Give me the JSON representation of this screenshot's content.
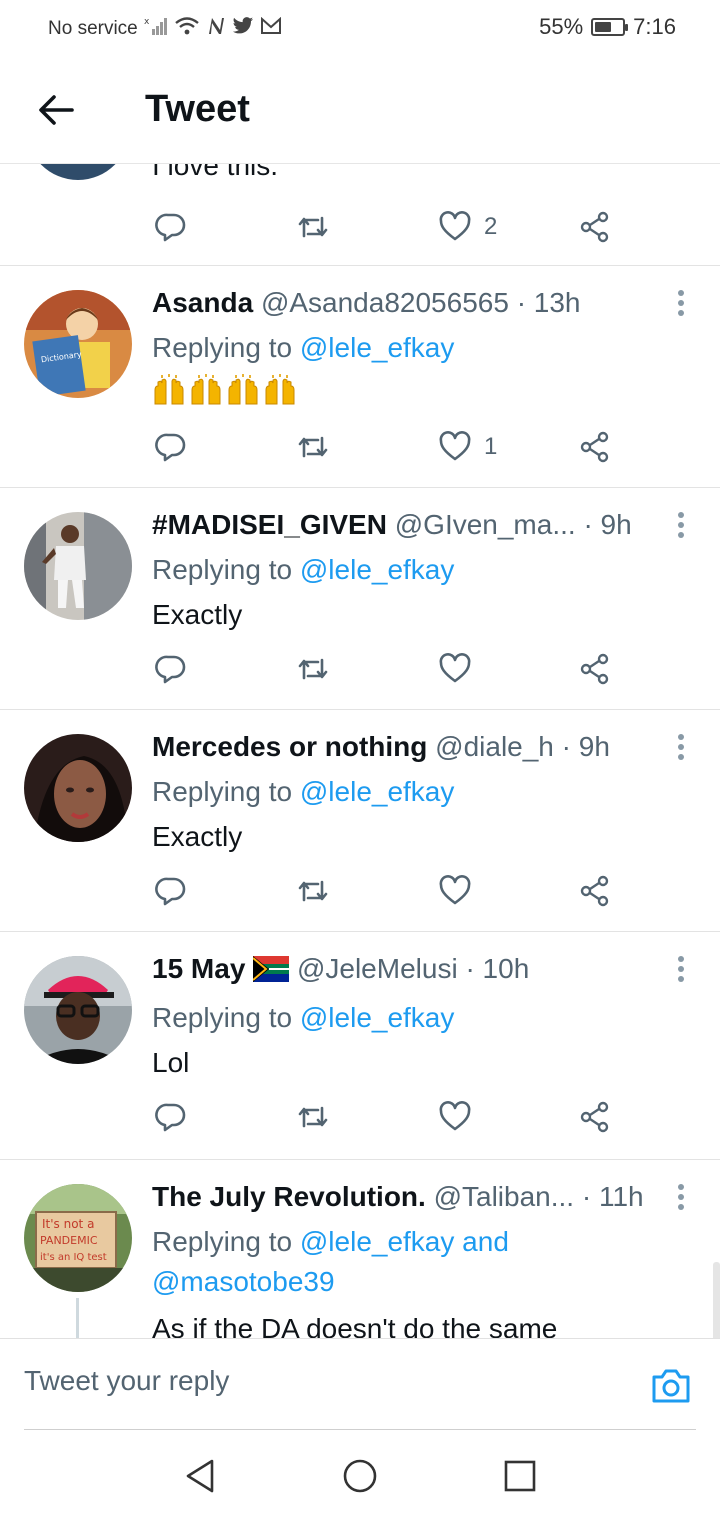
{
  "status_bar": {
    "carrier": "No service",
    "battery_percent": "55%",
    "battery_level": 0.55,
    "time": "7:16",
    "icons": [
      "signal-off-icon",
      "wifi-icon",
      "n-icon",
      "twitter-icon",
      "gmail-icon"
    ]
  },
  "header": {
    "title": "Tweet"
  },
  "partial_tweet": {
    "text": "I love this.",
    "like_count": "2"
  },
  "tweets": [
    {
      "name": "Asanda",
      "handle": "@Asanda82056565",
      "time": "· 13h",
      "replying_prefix": "Replying to ",
      "replying_to": "@lele_efkay",
      "body": "",
      "emoji": "raising-hands x4",
      "like_count": "1"
    },
    {
      "name": "#MADISEI_GIVEN",
      "handle": "@GIven_ma...",
      "time": "· 9h",
      "replying_prefix": "Replying to ",
      "replying_to": "@lele_efkay",
      "body": "Exactly",
      "like_count": ""
    },
    {
      "name": "Mercedes or nothing",
      "handle": "@diale_h",
      "time": "· 9h",
      "replying_prefix": "Replying to ",
      "replying_to": "@lele_efkay",
      "body": "Exactly",
      "like_count": ""
    },
    {
      "name": "15 May",
      "flag": "south-africa-flag",
      "handle": "@JeleMelusi",
      "time": "· 10h",
      "replying_prefix": "Replying to ",
      "replying_to": "@lele_efkay",
      "body": "Lol",
      "like_count": ""
    },
    {
      "name": "The July Revolution.",
      "handle": "@Taliban...",
      "time": "· 11h",
      "replying_prefix": "Replying to ",
      "replying_to": "@lele_efkay",
      "replying_and": " and",
      "replying_to_2": "@masotobe39",
      "body": "As if the DA doesn't do the same",
      "avatar_sign": [
        "It's not a",
        "PANDEMIC",
        "it's an IQ test"
      ]
    }
  ],
  "reply_bar": {
    "placeholder": "Tweet your reply"
  },
  "colors": {
    "accent": "#1d9bf0",
    "text": "#0f1419",
    "secondary": "#536471"
  }
}
